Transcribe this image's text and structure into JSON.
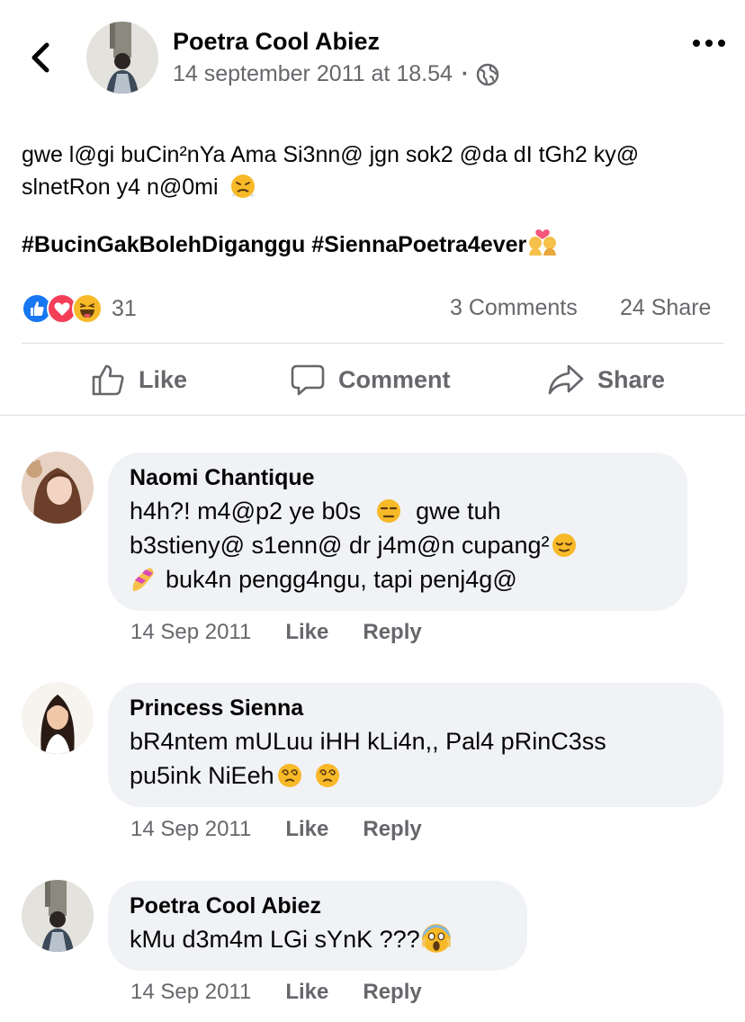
{
  "header": {
    "author": "Poetra Cool Abiez",
    "timestamp": "14 september 2011 at 18.54",
    "separator": "·",
    "audience_icon": "globe-icon"
  },
  "post": {
    "text": "gwe l@gi buCin²nYa Ama Si3nn@ jgn sok2 @da dI tGh2 ky@ slnetRon y4 n@0mi",
    "hashtags": "#BucinGakBolehDiganggu #SiennaPoetra4ever"
  },
  "stats": {
    "reaction_count": "31",
    "comments": "3 Comments",
    "shares": "24 Share"
  },
  "actions": {
    "like": "Like",
    "comment": "Comment",
    "share": "Share"
  },
  "comments": [
    {
      "name": "Naomi Chantique",
      "line1": "h4h?! m4@p2 ye b0s",
      "line1b": "gwe tuh",
      "line2": "b3stieny@ s1enn@ dr j4m@n cupang²",
      "line3": "buk4n pengg4ngu, tapi penj4g@",
      "date": "14 Sep 2011",
      "like": "Like",
      "reply": "Reply"
    },
    {
      "name": "Princess Sienna",
      "line1": "bR4ntem mULuu iHH kLi4n,, Pal4 pRinC3ss",
      "line2": "pu5ink NiEeh",
      "date": "14 Sep 2011",
      "like": "Like",
      "reply": "Reply"
    },
    {
      "name": "Poetra Cool Abiez",
      "line1": "kMu d3m4m LGi sYnK ???",
      "date": "14 Sep 2011",
      "like": "Like",
      "reply": "Reply"
    }
  ],
  "colors": {
    "like_blue": "#1877f2",
    "love_red": "#f33e58",
    "haha_yellow": "#f7b928",
    "muted_text": "#65676b",
    "bubble_bg": "#f0f2f5"
  }
}
